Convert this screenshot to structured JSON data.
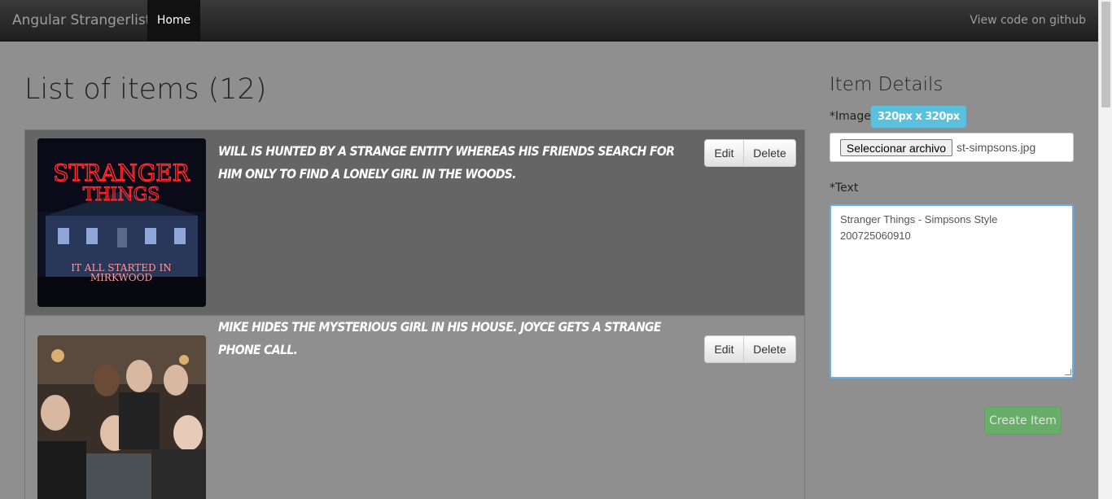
{
  "navbar": {
    "brand": "Angular Strangerlist",
    "home": "Home",
    "github": "View code on github"
  },
  "list": {
    "title": "List of items (12)",
    "items": [
      {
        "text": "Will is hunted by a strange entity whereas his friends search for him only to find a lonely girl in the woods.",
        "edit": "Edit",
        "delete": "Delete",
        "image": {
          "sign_top": "STRANGER",
          "sign_bottom": "THINGS",
          "caption1": "IT ALL STARTED IN",
          "caption2": "MIRKWOOD"
        }
      },
      {
        "text": "Mike hides the mysterious girl in his house. Joyce gets a strange phone call.",
        "edit": "Edit",
        "delete": "Delete"
      }
    ]
  },
  "details": {
    "title": "Item Details",
    "image_label": "*Image",
    "size_badge": "320px x 320px",
    "file_button": "Seleccionar archivo",
    "file_name": "st-simpsons.jpg",
    "text_label": "*Text",
    "text_value": "Stranger Things - Simpsons Style\n200725060910",
    "create_button": "Create Item"
  }
}
